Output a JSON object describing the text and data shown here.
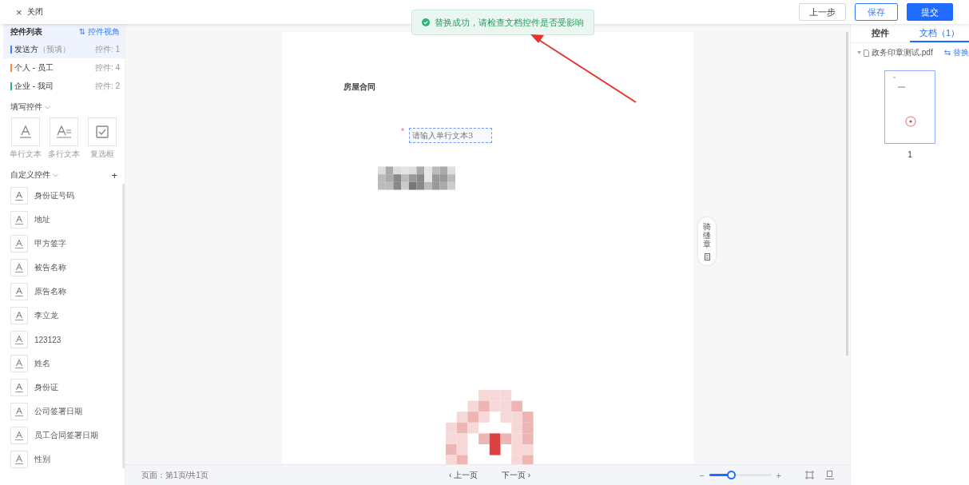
{
  "topbar": {
    "close_icon": "×",
    "close_label": "关闭",
    "buttons": [
      {
        "label": "上一步",
        "kind": "default"
      },
      {
        "label": "保存",
        "kind": "outline"
      },
      {
        "label": "提交",
        "kind": "primary"
      }
    ]
  },
  "toast": {
    "message": "替换成功，请检查文档控件是否受影响"
  },
  "sidebar": {
    "title": "控件列表",
    "view_link": "⇅ 控件视角",
    "signers": [
      {
        "name": "发送方",
        "note": "（预填）",
        "count": "控件: 1",
        "color": "#3b7cff",
        "selected": true
      },
      {
        "name": "个人 - 员工",
        "count": "控件: 4",
        "color": "#ff8a3d",
        "selected": false
      },
      {
        "name": "企业 - 我司",
        "count": "控件: 2",
        "color": "#2fb37a",
        "selected": false
      }
    ],
    "fill_section": {
      "title": "填写控件",
      "items": [
        {
          "label": "单行文本",
          "kind": "single"
        },
        {
          "label": "多行文本",
          "kind": "multi"
        },
        {
          "label": "复选框",
          "kind": "checkbox"
        }
      ]
    },
    "custom_section": {
      "title": "自定义控件",
      "add": "+",
      "items": [
        "身份证号码",
        "地址",
        "甲方签字",
        "被告名称",
        "原告名称",
        "李立龙",
        "123123",
        "姓名",
        "身份证",
        "公司签署日期",
        "员工合同签署日期",
        "性别"
      ]
    }
  },
  "document": {
    "title": "房屋合同",
    "field": {
      "placeholder": "请输入单行文本3",
      "required": true,
      "required_mark": "*"
    },
    "side_button": "骑缝章"
  },
  "footer": {
    "page_info": "页面：第1页/共1页",
    "prev_icon": "‹",
    "prev": "上一页",
    "next": "下一页",
    "next_icon": "›",
    "zoom_out": "−",
    "zoom_in": "+",
    "zoom": {
      "level": 0.35
    }
  },
  "right_panel": {
    "tabs": [
      {
        "label": "控件",
        "selected": false
      },
      {
        "label": "文档（1）",
        "selected": true
      }
    ],
    "file": {
      "name": "政务印章测试.pdf",
      "replace_icon": "⇆",
      "replace": "替换"
    },
    "page_number": "1"
  }
}
